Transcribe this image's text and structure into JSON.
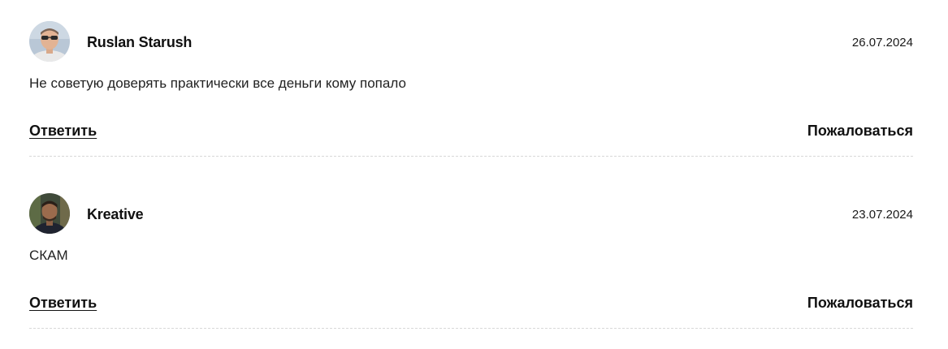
{
  "comments": [
    {
      "author": "Ruslan Starush",
      "date": "26.07.2024",
      "text": "Не советую доверять практически все деньги кому попало",
      "reply_label": "Ответить",
      "report_label": "Пожаловаться",
      "avatar": "user-photo-avatar"
    },
    {
      "author": "Kreative",
      "date": "23.07.2024",
      "text": "СКАМ",
      "reply_label": "Ответить",
      "report_label": "Пожаловаться",
      "avatar": "user-photo-avatar"
    }
  ]
}
